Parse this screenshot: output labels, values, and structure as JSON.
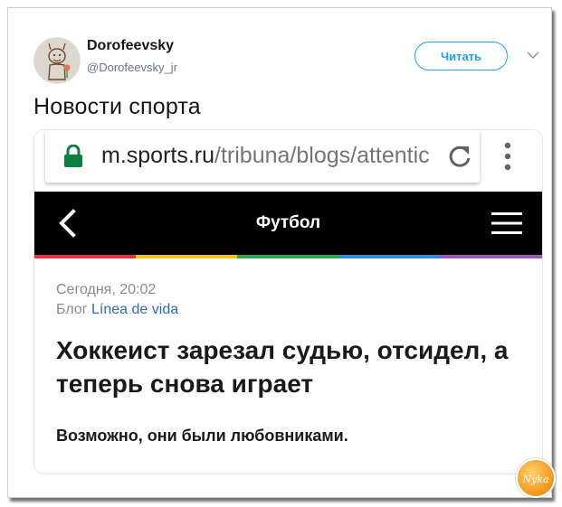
{
  "tweet": {
    "author_name": "Dorofeevsky",
    "author_handle": "@Dorofeevsky_jr",
    "follow_label": "Читать",
    "text": "Новости спорта"
  },
  "browser": {
    "url_host": "m.sports.ru",
    "url_path": "/tribuna/blogs/attentic"
  },
  "site": {
    "nav_title": "Футбол",
    "stripe_colors": [
      "#e8343a",
      "#f7c21a",
      "#2fa84f",
      "#2f8fd8",
      "#9b59b6"
    ]
  },
  "article": {
    "date": "Сегодня, 20:02",
    "blog_prefix": "Блог",
    "blog_name": "Línea de vida",
    "headline": "Хоккеист зарезал судью, отсидел, а теперь снова играет",
    "subline": "Возможно, они были любовниками."
  },
  "watermark": {
    "text": "Nyka"
  },
  "colors": {
    "twitter_blue": "#1da1f2",
    "lock_green": "#0b8043",
    "link_blue": "#2a6cba"
  }
}
